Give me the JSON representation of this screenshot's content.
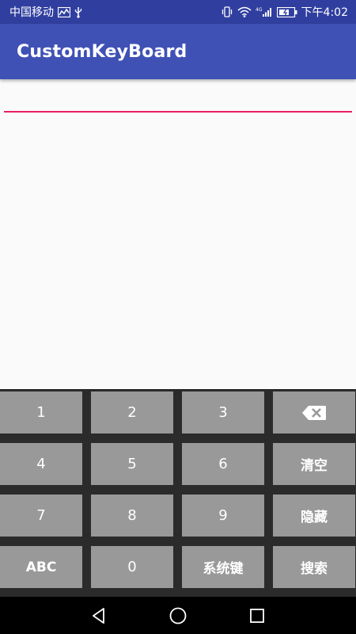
{
  "status_bar": {
    "carrier": "中国移动",
    "time": "下午4:02",
    "left_icons": [
      "activity-chart-icon",
      "usb-icon"
    ],
    "right_icons": [
      "vibrate-icon",
      "wifi-icon",
      "signal-4g-icon",
      "battery-icon"
    ]
  },
  "app_bar": {
    "title": "CustomKeyBoard"
  },
  "input": {
    "value": "",
    "placeholder": "",
    "accent_color": "#e91e63"
  },
  "keyboard": {
    "key_color": "#999999",
    "background_color": "#2b2b2b",
    "rows": [
      [
        {
          "label": "1"
        },
        {
          "label": "2"
        },
        {
          "label": "3"
        },
        {
          "label": "",
          "icon": "backspace-icon"
        }
      ],
      [
        {
          "label": "4"
        },
        {
          "label": "5"
        },
        {
          "label": "6"
        },
        {
          "label": "清空"
        }
      ],
      [
        {
          "label": "7"
        },
        {
          "label": "8"
        },
        {
          "label": "9"
        },
        {
          "label": "隐藏"
        }
      ],
      [
        {
          "label": "ABC"
        },
        {
          "label": "0"
        },
        {
          "label": "系统键"
        },
        {
          "label": "搜索"
        }
      ]
    ]
  },
  "nav_bar": {
    "icons": [
      "back-icon",
      "home-icon",
      "recents-icon"
    ]
  },
  "colors": {
    "primary": "#3f51b5",
    "primary_dark": "#303f9f",
    "accent": "#e91e63"
  }
}
